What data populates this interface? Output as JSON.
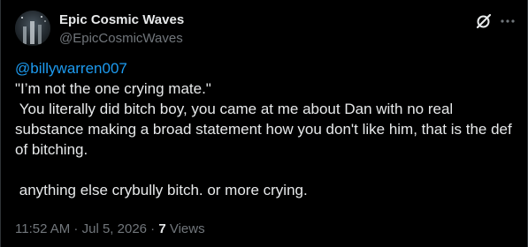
{
  "author": {
    "display_name": "Epic Cosmic Waves",
    "handle": "@EpicCosmicWaves"
  },
  "icons": {
    "grok": "grok-icon",
    "more": "more-icon",
    "avatar": "cosmic-avatar-image"
  },
  "tweet": {
    "mention": "@billywarren007",
    "line_quote": "\"I’m not the one crying mate.\"",
    "paragraph_1": " You literally did bitch boy, you came at me about Dan with no real substance making a broad statement how you don't like him, that is the def of bitching.",
    "paragraph_2": " anything else crybully bitch. or more crying."
  },
  "meta": {
    "time": "11:52 AM",
    "separator_1": " · ",
    "date": "Jul 5, 2026",
    "separator_2": " · ",
    "views_count": "7",
    "views_label": " Views"
  },
  "colors": {
    "background": "#000000",
    "text": "#e7e9ea",
    "secondary": "#71767b",
    "link": "#1d9bf0"
  }
}
